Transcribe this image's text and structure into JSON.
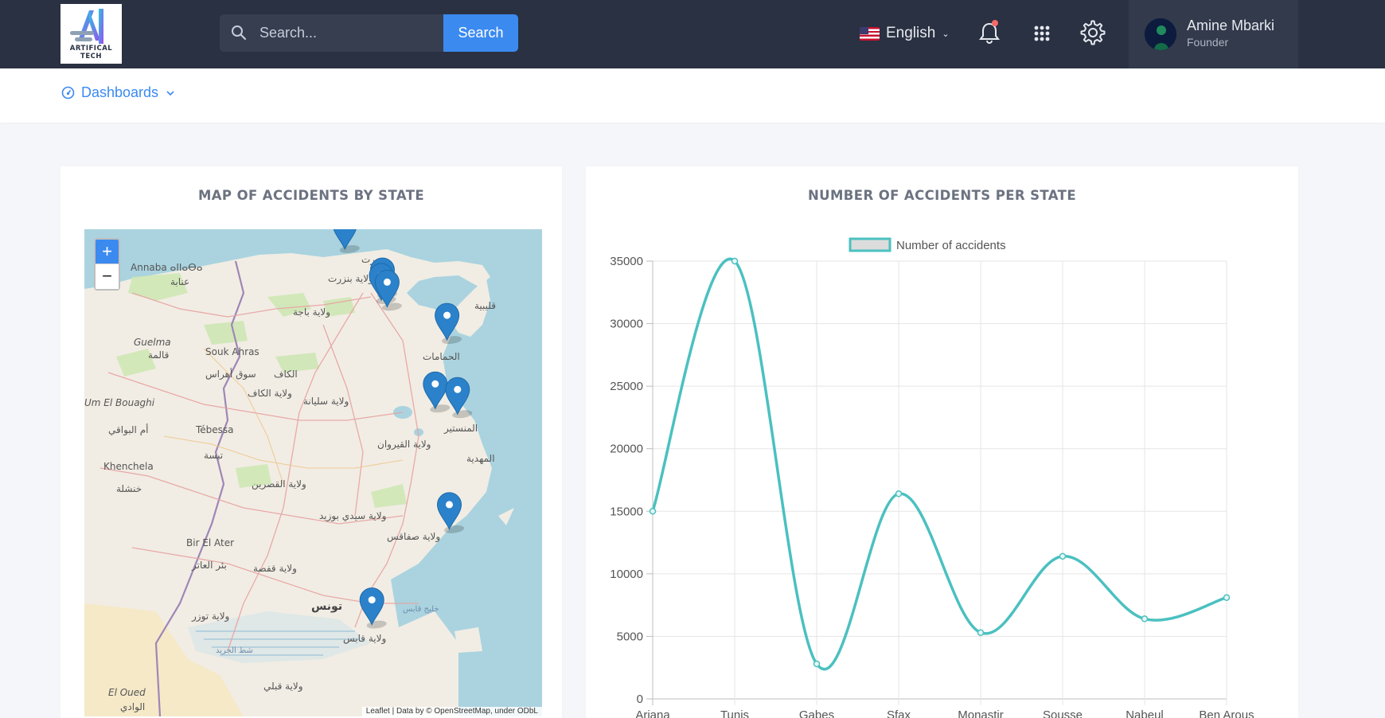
{
  "brand": {
    "logo_text": "ARTIFICAL TECH"
  },
  "search": {
    "placeholder": "Search...",
    "button_label": "Search"
  },
  "language": {
    "label": "English"
  },
  "user": {
    "name": "Amine Mbarki",
    "role": "Founder"
  },
  "nav": {
    "dashboards_label": "Dashboards"
  },
  "map_card": {
    "title": "MAP OF ACCIDENTS BY STATE",
    "zoom_in": "+",
    "zoom_out": "−",
    "attribution": "Leaflet | Data by © OpenStreetMap, under ODbL",
    "place_labels": [
      "Annaba ⴰⵏⵏⴰⴱⴰ",
      "عنابة",
      "Guelma",
      "قالمة",
      "Souk Ahras",
      "سوق أهراس",
      "Tébessa",
      "تبسة",
      "Khenchela",
      "خنشلة",
      "Bir El Ater",
      "بئر العاتر",
      "El Oued",
      "الوادي",
      "Um El Bouaghi",
      "أم البواقي",
      "ولاية بنزرت",
      "ولاية باجة",
      "الكاف",
      "ولاية الكاف",
      "ولاية سليانة",
      "ولاية القيروان",
      "ولاية القصرين",
      "ولاية سيدي بوزيد",
      "ولاية صفاقس",
      "ولاية قفصة",
      "تونس",
      "ولاية توزر",
      "ولاية قابس",
      "ولاية قبلي",
      "شط الجريد",
      "قليبية",
      "الحمامات",
      "المنستير",
      "المهدية",
      "بنزرت",
      "خليج قابس"
    ],
    "markers": [
      {
        "state": "Bizerte",
        "lat": 37.27,
        "lon": 9.87
      },
      {
        "state": "Ariana",
        "lat": 36.86,
        "lon": 10.19
      },
      {
        "state": "Tunis",
        "lat": 36.81,
        "lon": 10.18
      },
      {
        "state": "Ben Arous",
        "lat": 36.75,
        "lon": 10.23
      },
      {
        "state": "Nabeul",
        "lat": 36.45,
        "lon": 10.74
      },
      {
        "state": "Sousse",
        "lat": 35.83,
        "lon": 10.64
      },
      {
        "state": "Monastir",
        "lat": 35.78,
        "lon": 10.83
      },
      {
        "state": "Sfax",
        "lat": 34.74,
        "lon": 10.76
      },
      {
        "state": "Gabes",
        "lat": 33.88,
        "lon": 10.1
      }
    ]
  },
  "chart_card": {
    "title": "NUMBER OF ACCIDENTS PER STATE"
  },
  "chart_data": {
    "type": "line",
    "categories": [
      "Ariana",
      "Tunis",
      "Gabes",
      "Sfax",
      "Monastir",
      "Sousse",
      "Nabeul",
      "Ben Arous"
    ],
    "series": [
      {
        "name": "Number of accidents",
        "values": [
          15000,
          35000,
          2800,
          16400,
          5300,
          11400,
          6400,
          8100
        ]
      }
    ],
    "ylim": [
      0,
      35000
    ],
    "yticks": [
      0,
      5000,
      10000,
      15000,
      20000,
      25000,
      30000,
      35000
    ],
    "legend": "top",
    "grid": true,
    "colors": {
      "line": "#4bc0c0",
      "legend_fill": "#dcdcdc"
    }
  }
}
